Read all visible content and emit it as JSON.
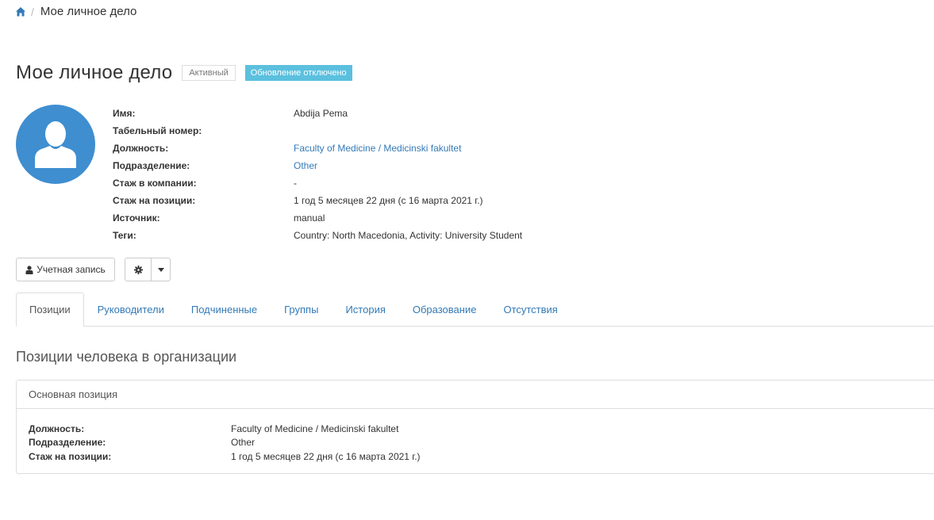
{
  "breadcrumb": {
    "home_icon": "home-icon",
    "current": "Мое личное дело"
  },
  "header": {
    "title": "Мое личное дело",
    "status_badge": "Активный",
    "update_badge": "Обновление отключено"
  },
  "profile": {
    "avatar_icon": "user-avatar-icon",
    "fields": [
      {
        "label": "Имя:",
        "value": "Abdija Pema"
      },
      {
        "label": "Табельный номер:",
        "value": ""
      },
      {
        "label": "Должность:",
        "value": "Faculty of Medicine / Medicinski fakultet"
      },
      {
        "label": "Подразделение:",
        "value": "Other"
      },
      {
        "label": "Стаж в компании:",
        "value": "-"
      },
      {
        "label": "Стаж на позиции:",
        "value": "1 год 5 месяцев 22 дня (с 16 марта 2021 г.)"
      },
      {
        "label": "Источник:",
        "value": "manual"
      },
      {
        "label": "Теги:",
        "value": "Country: North Macedonia, Activity: University Student"
      }
    ]
  },
  "actions": {
    "account_label": "Учетная запись",
    "account_icon": "user-icon",
    "settings_icon": "gear-icon",
    "dropdown_icon": "caret-down-icon"
  },
  "tabs": [
    {
      "label": "Позиции"
    },
    {
      "label": "Руководители"
    },
    {
      "label": "Подчиненные"
    },
    {
      "label": "Группы"
    },
    {
      "label": "История"
    },
    {
      "label": "Образование"
    },
    {
      "label": "Отсутствия"
    }
  ],
  "positions": {
    "section_title": "Позиции человека в организации",
    "panel_title": "Основная позиция",
    "fields": [
      {
        "label": "Должность:",
        "value": "Faculty of Medicine / Medicinski fakultet"
      },
      {
        "label": "Подразделение:",
        "value": "Other"
      },
      {
        "label": "Стаж на позиции:",
        "value": "1 год 5 месяцев 22 дня (с 16 марта 2021 г.)"
      }
    ]
  },
  "colors": {
    "link": "#337ab7",
    "avatar_bg": "#3f8ed0",
    "info_badge": "#5bc0de"
  }
}
